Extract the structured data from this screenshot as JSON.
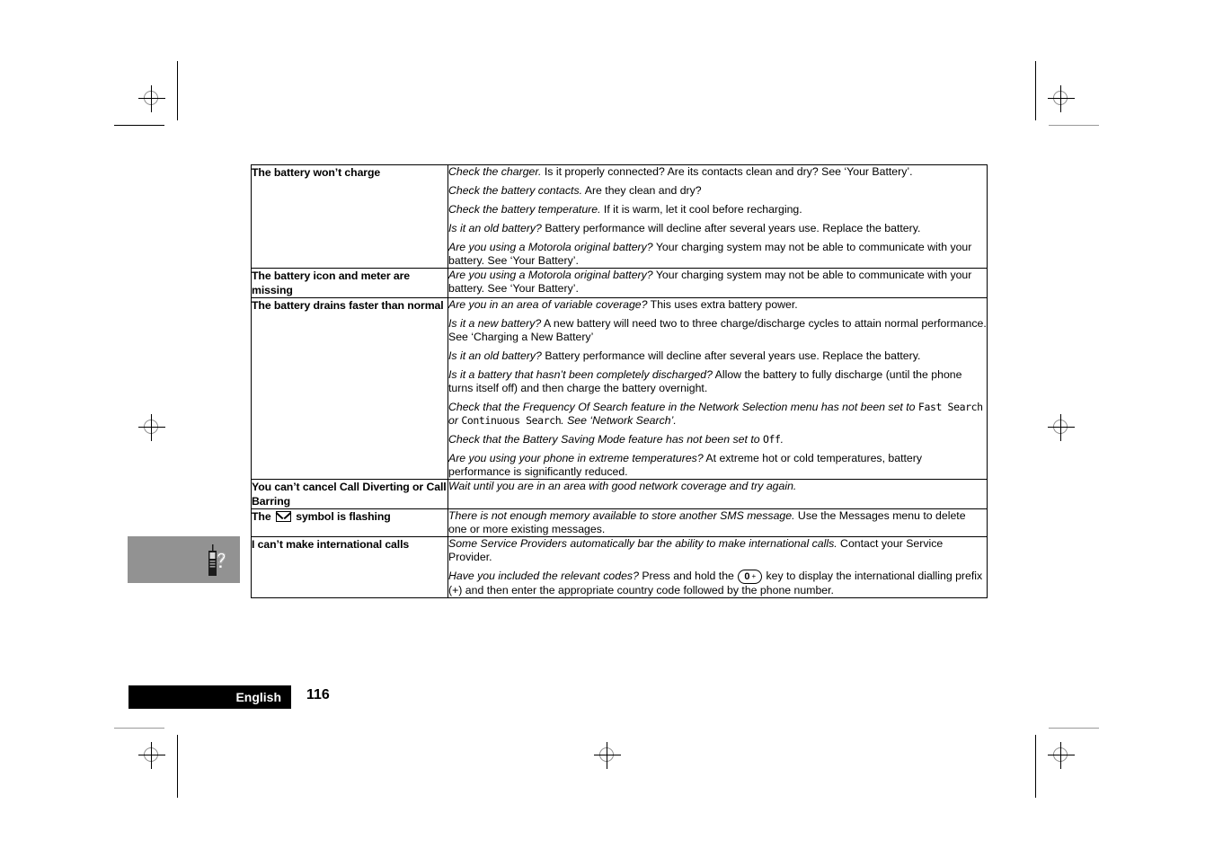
{
  "document": {
    "page_number": "116",
    "language_label": "English",
    "side_tab_icon": "phone-question-icon"
  },
  "table": {
    "rows": [
      {
        "symptom": "The battery won’t charge",
        "fixes": [
          {
            "lead": "Check the charger.",
            "rest": " Is it properly connected? Are its contacts clean and dry? See ‘Your Battery’."
          },
          {
            "lead": "Check the battery contacts.",
            "rest": " Are they clean and dry?"
          },
          {
            "lead": "Check the battery temperature.",
            "rest": " If it is warm, let it cool before recharging."
          },
          {
            "lead": "Is it an old battery?",
            "rest": " Battery performance will decline after several years use. Replace the battery."
          },
          {
            "lead": "Are you using a Motorola original battery?",
            "rest": " Your charging system may not be able to communicate with your battery. See ‘Your Battery’."
          }
        ]
      },
      {
        "symptom": "The battery icon and meter are missing",
        "fixes": [
          {
            "lead": "Are you using a Motorola original battery?",
            "rest": " Your charging system may not be able to communicate with your battery. See ‘Your Battery’."
          }
        ]
      },
      {
        "symptom": "The battery drains faster than normal",
        "fixes": [
          {
            "lead": "Are you in an area of variable coverage?",
            "rest": " This uses extra battery power."
          },
          {
            "lead": "Is it a new battery?",
            "rest": " A new battery will need two to three charge/discharge cycles to attain normal performance. See ‘Charging a New Battery’"
          },
          {
            "lead": "Is it an old battery?",
            "rest": " Battery performance will decline after several years use. Replace the battery."
          },
          {
            "lead": "Is it a battery that hasn’t been completely discharged?",
            "rest": " Allow the battery to fully discharge (until the phone turns itself off) and then charge the battery overnight."
          },
          {
            "lead": "Check that the Frequency Of Search feature in the Network Selection menu has not been set to ",
            "lcd1": "Fast Search",
            "mid": " or ",
            "lcd2": "Continuous  Search",
            "rest": ". See ‘Network Search’."
          },
          {
            "lead": "Check that the Battery Saving Mode feature has not been set to ",
            "lcd1": "Off",
            "rest": "."
          },
          {
            "lead": "Are you using your phone in extreme temperatures?",
            "rest": " At extreme hot or cold temperatures, battery performance is significantly reduced."
          }
        ]
      },
      {
        "symptom": "You can’t cancel Call Diverting or Call Barring",
        "fixes": [
          {
            "lead": "Wait until you are in an area with good network coverage and try again.",
            "rest": ""
          }
        ]
      },
      {
        "symptom_pre": "The ",
        "symptom_icon": "envelope-icon",
        "symptom_post": " symbol is flashing",
        "fixes": [
          {
            "lead": "There is not enough memory available to store another SMS message.",
            "rest": " Use the Messages menu to delete one or more existing messages."
          }
        ]
      },
      {
        "symptom": "I can’t make international calls",
        "fixes": [
          {
            "lead": "Some Service Providers automatically bar the ability to make international calls.",
            "rest": " Contact your Service Provider."
          },
          {
            "lead": "Have you included the relevant codes?",
            "mid": " Press and hold the ",
            "key_main": "0",
            "key_sup": "+",
            "rest": " key to display the international dialling prefix (+) and then enter the appropriate country code followed by the phone number."
          }
        ]
      }
    ]
  }
}
